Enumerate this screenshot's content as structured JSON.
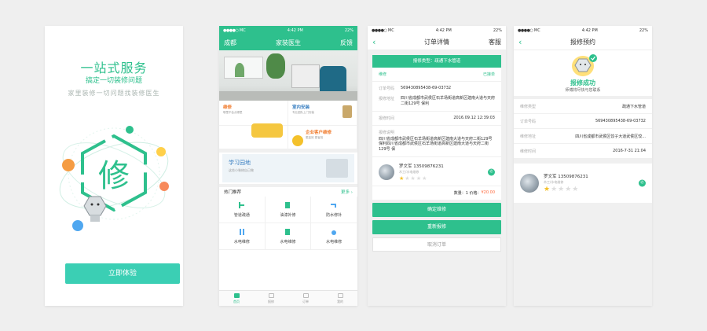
{
  "colors": {
    "brand": "#2ec08d",
    "cta": "#3bcfb4",
    "price": "#ff6a3d",
    "star": "#f4c12b"
  },
  "status": {
    "carrier": "MC",
    "time": "4:42 PM",
    "battery": "22%"
  },
  "splash": {
    "title": "一站式服务",
    "subtitle": "搞定一切装修问题",
    "slogan": "家里装修一切问题找装修医生",
    "emblem_char": "修",
    "cta_label": "立即体验"
  },
  "home": {
    "city": "成都",
    "title": "家装医生",
    "feedback": "反馈",
    "categories": [
      {
        "title": "维修",
        "subtitle": "哪里不会点哪里"
      },
      {
        "title": "室内安装",
        "subtitle": "专业团队上门安装"
      },
      {
        "title": "",
        "subtitle": ""
      },
      {
        "title": "企业客户维修",
        "subtitle": "更高效 更省钱"
      }
    ],
    "learn": {
      "title": "学习园地",
      "subtitle": "这些小装修自己做"
    },
    "hot_title": "热门推荐",
    "more_label": "更多",
    "hot_items": [
      "管道疏通",
      "油漆补修",
      "防水修补",
      "水电维修",
      "水电维修",
      "水电维修"
    ],
    "tabs": [
      "首页",
      "报修",
      "订单",
      "我的"
    ]
  },
  "order": {
    "nav_title": "订单详情",
    "service": "客服",
    "type_label": "报修类型：疏通下水管道",
    "category": "维修",
    "status": "已接单",
    "fields": [
      {
        "k": "订单号码",
        "v": "569430895438-69-03732"
      },
      {
        "k": "报修地址",
        "v": "四川省成都市武侯区石羊场街道高新区建南大道与天府二街129号 保利"
      },
      {
        "k": "报修时间",
        "v": "2016.09.12 12:39:03"
      },
      {
        "k": "报修说明",
        "v": "四川省成都市武侯区石羊场街道高新区建南大道与天府二街129号 保利四川省成都市武侯区石羊场街道高新区建南大道与天府二街129号 保"
      }
    ],
    "worker": {
      "name": "罗文军 13509876231",
      "role": "木工/水电维修",
      "rating": 1
    },
    "qty_label": "数量：1  价格：",
    "price": "¥20.00",
    "buttons": {
      "confirm": "确定维修",
      "redo": "重新报修",
      "cancel": "取消订单"
    }
  },
  "repair": {
    "nav_title": "报修预约",
    "success_title": "报修成功",
    "success_sub": "师傅将尽快与您联系",
    "fields": [
      {
        "k": "维修类型",
        "v": "疏通下水管道"
      },
      {
        "k": "订单号码",
        "v": "569430895438-69-03732"
      },
      {
        "k": "维修地址",
        "v": "四川省成都市武侯区饺子大道武侯区饺..."
      },
      {
        "k": "维修时间",
        "v": "2016-7-31 21:04"
      }
    ],
    "worker": {
      "name": "罗文军 13509876231",
      "role": "木工/水电维修",
      "rating": 1
    }
  }
}
